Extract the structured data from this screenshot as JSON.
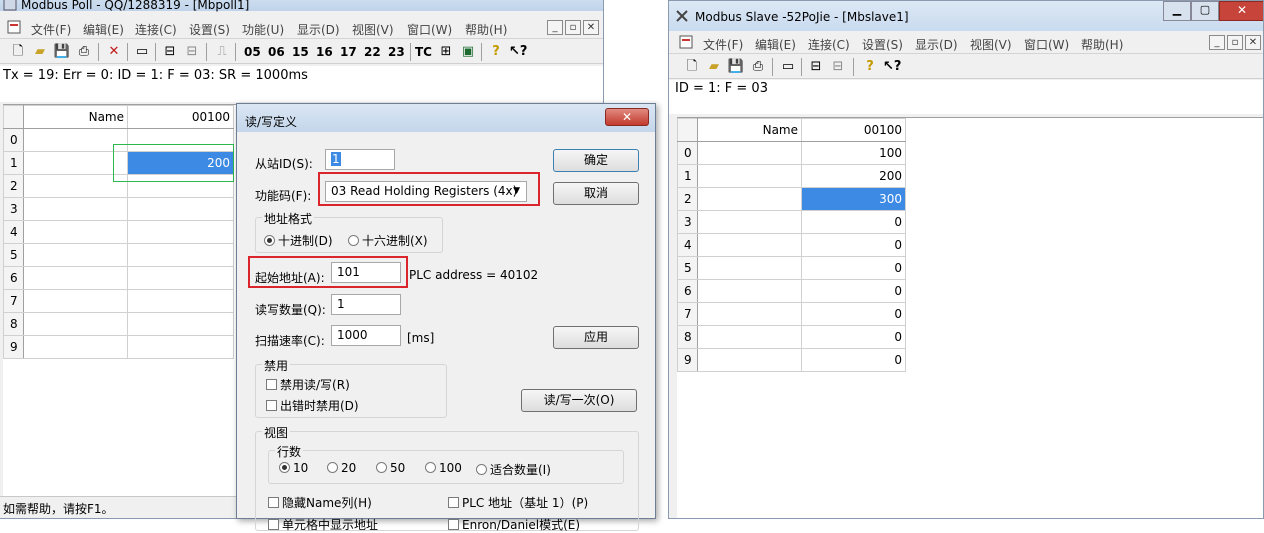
{
  "poll": {
    "title": "Modbus Poll - QQ/1288319 - [Mbpoll1]",
    "menu": [
      "文件(F)",
      "编辑(E)",
      "连接(C)",
      "设置(S)",
      "功能(U)",
      "显示(D)",
      "视图(V)",
      "窗口(W)",
      "帮助(H)"
    ],
    "toolbar_codes": [
      "05",
      "06",
      "15",
      "16",
      "17",
      "22",
      "23",
      "TC"
    ],
    "status": "Tx = 19: Err = 0: ID = 1: F = 03: SR = 1000ms",
    "col_name": "Name",
    "col_addr": "00100",
    "rows": [
      {
        "idx": "0",
        "val": ""
      },
      {
        "idx": "1",
        "val": "200"
      },
      {
        "idx": "2",
        "val": ""
      },
      {
        "idx": "3",
        "val": ""
      },
      {
        "idx": "4",
        "val": ""
      },
      {
        "idx": "5",
        "val": ""
      },
      {
        "idx": "6",
        "val": ""
      },
      {
        "idx": "7",
        "val": ""
      },
      {
        "idx": "8",
        "val": ""
      },
      {
        "idx": "9",
        "val": ""
      }
    ],
    "help": "如需帮助，请按F1。"
  },
  "slave": {
    "title": "Modbus Slave -52PoJie - [Mbslave1]",
    "menu": [
      "文件(F)",
      "编辑(E)",
      "连接(C)",
      "设置(S)",
      "显示(D)",
      "视图(V)",
      "窗口(W)",
      "帮助(H)"
    ],
    "status": "ID = 1: F = 03",
    "col_name": "Name",
    "col_addr": "00100",
    "rows": [
      {
        "idx": "0",
        "val": "100"
      },
      {
        "idx": "1",
        "val": "200"
      },
      {
        "idx": "2",
        "val": "300"
      },
      {
        "idx": "3",
        "val": "0"
      },
      {
        "idx": "4",
        "val": "0"
      },
      {
        "idx": "5",
        "val": "0"
      },
      {
        "idx": "6",
        "val": "0"
      },
      {
        "idx": "7",
        "val": "0"
      },
      {
        "idx": "8",
        "val": "0"
      },
      {
        "idx": "9",
        "val": "0"
      }
    ]
  },
  "dialog": {
    "title": "读/写定义",
    "slave_id_label": "从站ID(S):",
    "slave_id": "1",
    "func_label": "功能码(F):",
    "func_value": "03 Read Holding Registers (4x)",
    "addr_fmt_label": "地址格式",
    "dec_label": "十进制(D)",
    "hex_label": "十六进制(X)",
    "start_label": "起始地址(A):",
    "start_value": "101",
    "plc_addr": "PLC address = 40102",
    "qty_label": "读写数量(Q):",
    "qty_value": "1",
    "scan_label": "扫描速率(C):",
    "scan_value": "1000",
    "scan_unit": "[ms]",
    "ok": "确定",
    "cancel": "取消",
    "apply": "应用",
    "disable_label": "禁用",
    "disable_rw": "禁用读/写(R)",
    "disable_err": "出错时禁用(D)",
    "rw_once": "读/写一次(O)",
    "view_label": "视图",
    "rows_label": "行数",
    "rows_opts": [
      "10",
      "20",
      "50",
      "100",
      "适合数量(I)"
    ],
    "hide_name": "隐藏Name列(H)",
    "plc_base": "PLC 地址（基址 1）(P)",
    "cell_addr": "单元格中显示地址",
    "enron": "Enron/Daniel模式(E)"
  }
}
